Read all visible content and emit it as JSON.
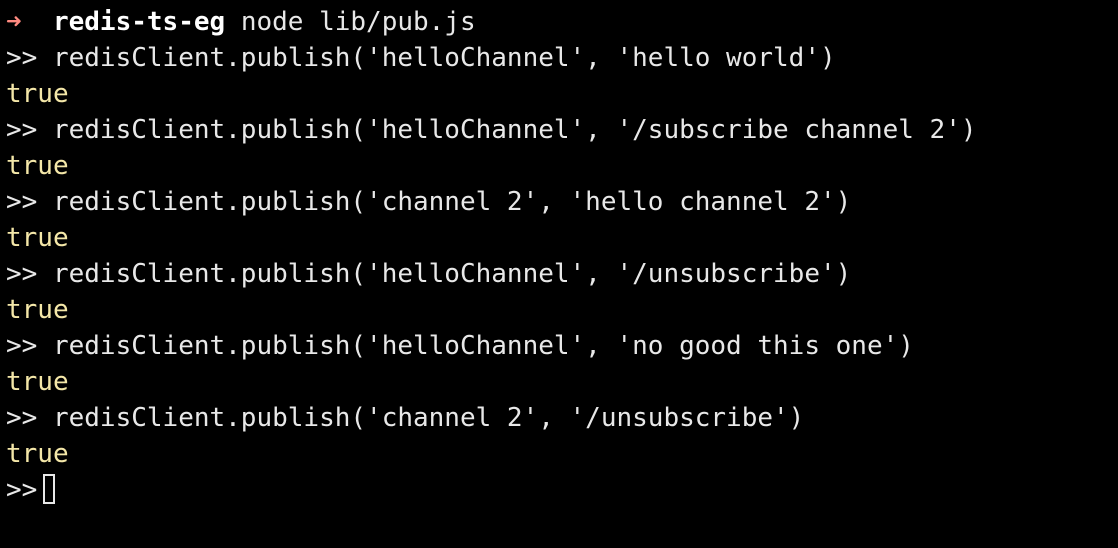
{
  "shell": {
    "arrow": "➜",
    "directory": "redis-ts-eg",
    "command": "node lib/pub.js"
  },
  "repl": {
    "prompt": ">>",
    "entries": [
      {
        "input": "redisClient.publish('helloChannel', 'hello world')",
        "output": "true"
      },
      {
        "input": "redisClient.publish('helloChannel', '/subscribe channel 2')",
        "output": "true"
      },
      {
        "input": "redisClient.publish('channel 2', 'hello channel 2')",
        "output": "true"
      },
      {
        "input": "redisClient.publish('helloChannel', '/unsubscribe')",
        "output": "true"
      },
      {
        "input": "redisClient.publish('helloChannel', 'no good this one')",
        "output": "true"
      },
      {
        "input": "redisClient.publish('channel 2', '/unsubscribe')",
        "output": "true"
      }
    ]
  },
  "colors": {
    "background": "#000000",
    "arrow": "#ff8a80",
    "result": "#f4e7a8",
    "text": "#e8e8e8"
  }
}
